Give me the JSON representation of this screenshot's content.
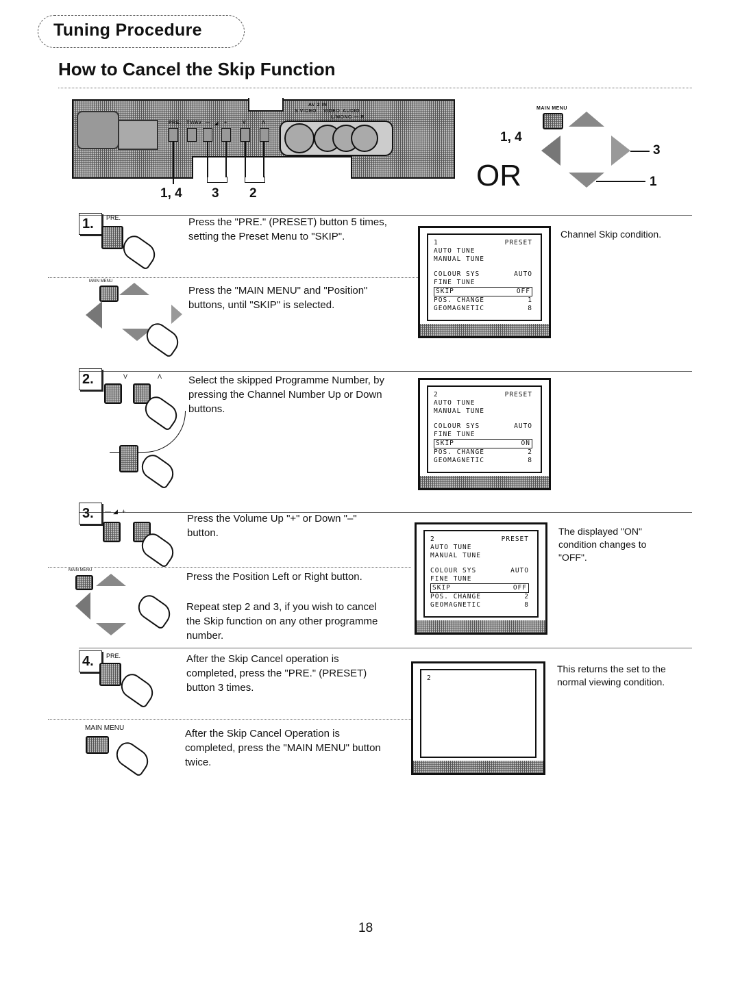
{
  "header": {
    "section_title": "Tuning Procedure",
    "page_title": "How to Cancel the Skip Function"
  },
  "front_panel": {
    "button_labels": [
      "PRE.",
      "TV/AV",
      "—",
      "◢",
      "+",
      "V",
      "Λ"
    ],
    "av_label": "AV 2 IN",
    "jack_labels": [
      "S VIDEO",
      "VIDEO",
      "AUDIO",
      "L/MONO — R"
    ],
    "callouts": [
      "1, 4",
      "3",
      "2"
    ]
  },
  "remote": {
    "main_menu_label": "MAIN MENU",
    "callouts": [
      "1, 4",
      "3",
      "1"
    ],
    "or_label": "OR"
  },
  "steps": [
    {
      "number": "1.",
      "button_label": "PRE.",
      "instructions": [
        "Press the \"PRE.\" (PRESET) button 5 times,",
        "setting the Preset Menu to \"SKIP\"."
      ],
      "sub_button_label": "MAIN MENU",
      "sub_instructions": [
        "Press the \"MAIN MENU\" and \"Position\"",
        "buttons, until \"SKIP\" is selected."
      ],
      "caption": [
        "Channel Skip condition."
      ]
    },
    {
      "number": "2.",
      "button_labels": [
        "V",
        "Λ"
      ],
      "instructions": [
        "Select the skipped Programme Number, by",
        "pressing the Channel Number Up or Down",
        "buttons."
      ]
    },
    {
      "number": "3.",
      "button_labels": [
        "—",
        "◢",
        "+"
      ],
      "instructions": [
        "Press the Volume Up \"+\" or Down \"–\"",
        "button."
      ],
      "sub_button_label": "MAIN MENU",
      "sub_instructions": [
        "Press the Position Left or Right button."
      ],
      "repeat_instructions": [
        "Repeat step 2 and 3, if you wish to cancel",
        "the Skip function on any other programme",
        "number."
      ],
      "caption": [
        "The displayed \"ON\"",
        "condition changes to",
        "\"OFF\"."
      ]
    },
    {
      "number": "4.",
      "button_label": "PRE.",
      "instructions": [
        "After the Skip Cancel operation is",
        "completed, press the \"PRE.\" (PRESET)",
        "button 3 times."
      ],
      "sub_button_label": "MAIN MENU",
      "sub_instructions": [
        "After the Skip Cancel Operation is",
        "completed, press the \"MAIN MENU\" button",
        "twice."
      ],
      "caption": [
        "This returns the set to the",
        "normal viewing condition."
      ]
    }
  ],
  "screens": [
    {
      "rows": [
        [
          "1",
          "PRESET"
        ],
        [
          "AUTO TUNE",
          ""
        ],
        [
          "MANUAL TUNE",
          ""
        ],
        null,
        [
          "COLOUR SYS",
          "AUTO"
        ],
        [
          "FINE TUNE",
          ""
        ],
        [
          "SKIP",
          "OFF",
          "hl"
        ],
        [
          "POS. CHANGE",
          "1"
        ],
        [
          "GEOMAGNETIC",
          "8"
        ]
      ]
    },
    {
      "rows": [
        [
          "2",
          "PRESET"
        ],
        [
          "AUTO TUNE",
          ""
        ],
        [
          "MANUAL TUNE",
          ""
        ],
        null,
        [
          "COLOUR SYS",
          "AUTO"
        ],
        [
          "FINE TUNE",
          ""
        ],
        [
          "SKIP",
          "ON",
          "hl"
        ],
        [
          "POS. CHANGE",
          "2"
        ],
        [
          "GEOMAGNETIC",
          "8"
        ]
      ]
    },
    {
      "rows": [
        [
          "2",
          "PRESET"
        ],
        [
          "AUTO TUNE",
          ""
        ],
        [
          "MANUAL TUNE",
          ""
        ],
        null,
        [
          "COLOUR SYS",
          "AUTO"
        ],
        [
          "FINE TUNE",
          ""
        ],
        [
          "SKIP",
          "OFF",
          "hl"
        ],
        [
          "POS. CHANGE",
          "2"
        ],
        [
          "GEOMAGNETIC",
          "8"
        ]
      ]
    },
    {
      "rows": [
        [
          "2",
          ""
        ]
      ]
    }
  ],
  "footer": {
    "page_number": "18"
  }
}
